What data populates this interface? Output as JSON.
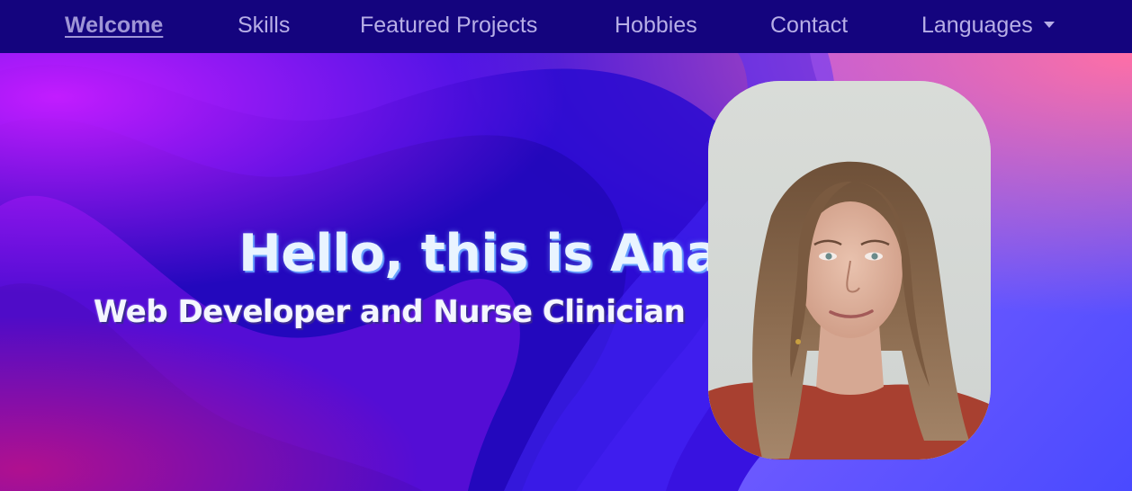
{
  "nav": {
    "items": [
      {
        "label": "Welcome"
      },
      {
        "label": "Skills"
      },
      {
        "label": "Featured Projects"
      },
      {
        "label": "Hobbies"
      },
      {
        "label": "Contact"
      },
      {
        "label": "Languages"
      }
    ],
    "active_label": "Welcome"
  },
  "hero": {
    "title": "Hello, this is Ana",
    "subtitle": "Web Developer and Nurse Clinician"
  },
  "colors": {
    "navbar_bg": "#14047e",
    "nav_text": "#b7aee6",
    "hero_base": "#3a10e0",
    "accent_magenta": "#c21cff"
  },
  "icons": {
    "dropdown": "caret-down-icon"
  }
}
